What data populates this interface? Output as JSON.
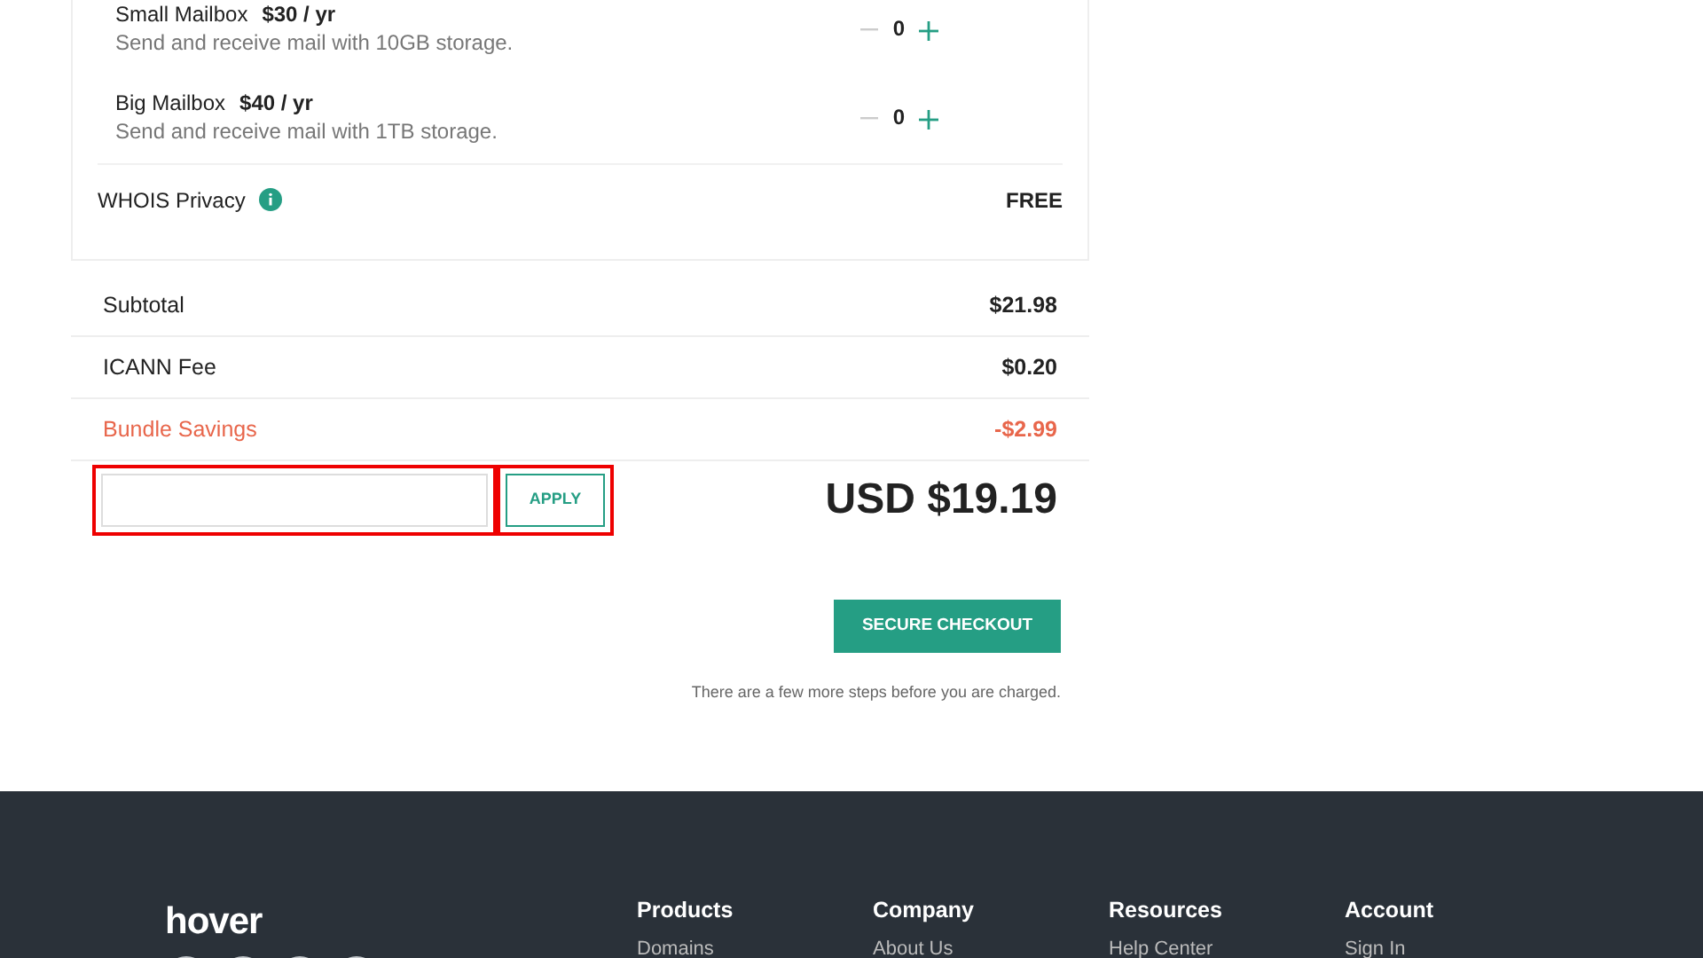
{
  "addons": [
    {
      "name": "Small Mailbox",
      "price": "$30 / yr",
      "description": "Send and receive mail with 10GB storage.",
      "quantity": "0"
    },
    {
      "name": "Big Mailbox",
      "price": "$40 / yr",
      "description": "Send and receive mail with 1TB storage.",
      "quantity": "0"
    }
  ],
  "privacy": {
    "label": "WHOIS Privacy",
    "value": "FREE"
  },
  "summary": [
    {
      "label": "Subtotal",
      "amount": "$21.98",
      "kind": "normal"
    },
    {
      "label": "ICANN Fee",
      "amount": "$0.20",
      "kind": "normal"
    },
    {
      "label": "Bundle Savings",
      "amount": "-$2.99",
      "kind": "savings"
    }
  ],
  "promo": {
    "button": "APPLY",
    "highlighted": true
  },
  "total": "USD $19.19",
  "checkout": {
    "button": "SECURE CHECKOUT",
    "note": "There are a few more steps before you are charged."
  },
  "footer": {
    "logo": "hover",
    "columns": [
      {
        "heading": "Products",
        "links": [
          "Domains"
        ]
      },
      {
        "heading": "Company",
        "links": [
          "About Us"
        ]
      },
      {
        "heading": "Resources",
        "links": [
          "Help Center"
        ]
      },
      {
        "heading": "Account",
        "links": [
          "Sign In"
        ]
      }
    ]
  }
}
